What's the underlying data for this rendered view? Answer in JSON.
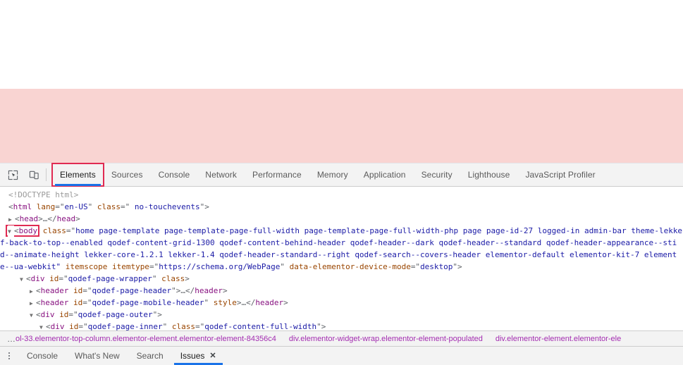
{
  "viewport": {
    "highlight_color": "#f9d4d2",
    "background": "#ffffff"
  },
  "devtools": {
    "accent_color": "#1a73e8",
    "annotation_box_color": "#e02a52",
    "toolbar": {
      "icons": [
        {
          "name": "inspect-element-icon",
          "title": "Inspect element"
        },
        {
          "name": "device-toolbar-icon",
          "title": "Toggle device toolbar"
        }
      ],
      "tabs": [
        {
          "label": "Elements",
          "selected": true,
          "boxed": true
        },
        {
          "label": "Sources",
          "selected": false,
          "boxed": false
        },
        {
          "label": "Console",
          "selected": false,
          "boxed": false
        },
        {
          "label": "Network",
          "selected": false,
          "boxed": false
        },
        {
          "label": "Performance",
          "selected": false,
          "boxed": false
        },
        {
          "label": "Memory",
          "selected": false,
          "boxed": false
        },
        {
          "label": "Application",
          "selected": false,
          "boxed": false
        },
        {
          "label": "Security",
          "selected": false,
          "boxed": false
        },
        {
          "label": "Lighthouse",
          "selected": false,
          "boxed": false
        },
        {
          "label": "JavaScript Profiler",
          "selected": false,
          "boxed": false
        }
      ]
    },
    "dom": {
      "line1": "<!DOCTYPE html>",
      "line2_tag": "html",
      "line2_attr1_name": "lang",
      "line2_attr1_value": "en-US",
      "line2_attr2_name": "class",
      "line2_attr2_value": " no-touchevents",
      "line3_tag": "head",
      "body_tag": "body",
      "body_attr_name": "class",
      "body_class_line1": "home page-template page-template-page-full-width page-template-page-full-width-php page page-id-27 logged-in admin-bar theme-lekke",
      "body_class_line2": "f-back-to-top--enabled qodef-content-grid-1300 qodef-content-behind-header qodef-header--dark qodef-header--standard qodef-header-appearance--sti",
      "body_class_line3": "d--animate-height lekker-core-1.2.1 lekker-1.4 qodef-header-standard--right qodef-search--covers-header elementor-default elementor-kit-7 element",
      "body_class_line4": "e--ua-webkit\"",
      "body_attr2_name": "itemscope",
      "body_attr3_name": "itemtype",
      "body_attr3_value": "https://schema.org/WebPage",
      "body_attr4_name": "data-elementor-device-mode",
      "body_attr4_value": "desktop",
      "wrapper_tag": "div",
      "wrapper_attr_name": "id",
      "wrapper_attr_value": "qodef-page-wrapper",
      "wrapper_attr2_name": "class",
      "header_tag": "header",
      "header_attr_name": "id",
      "header_attr_value": "qodef-page-header",
      "mobile_header_attr_value": "qodef-page-mobile-header",
      "mobile_header_attr2_name": "style",
      "outer_attr_value": "qodef-page-outer",
      "inner_attr_value": "qodef-page-inner",
      "inner_attr2_name": "class",
      "inner_attr2_value": "qodef-content-full-width",
      "ellipsis": "…"
    },
    "breadcrumbs": {
      "overflow_label": "…",
      "items": [
        "ol-33.elementor-top-column.elementor-element.elementor-element-84356c4",
        "div.elementor-widget-wrap.elementor-element-populated",
        "div.elementor-element.elementor-ele"
      ]
    },
    "drawer": {
      "more_label": "more-options",
      "tabs": [
        {
          "label": "Console",
          "selected": false,
          "closable": false
        },
        {
          "label": "What's New",
          "selected": false,
          "closable": false
        },
        {
          "label": "Search",
          "selected": false,
          "closable": false
        },
        {
          "label": "Issues",
          "selected": true,
          "closable": true,
          "close_label": "✕"
        }
      ]
    }
  }
}
